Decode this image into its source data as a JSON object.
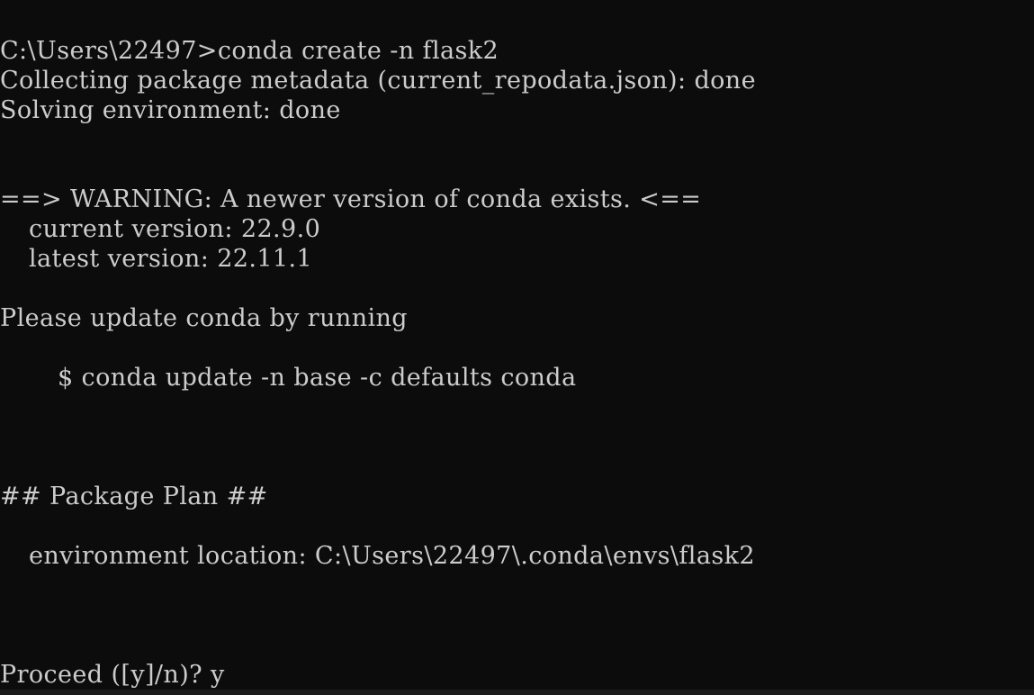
{
  "terminal": {
    "lines": {
      "cmd": "C:\\Users\\22497>conda create -n flask2",
      "collecting": "Collecting package metadata (current_repodata.json): done",
      "solving": "Solving environment: done",
      "warning": "==> WARNING: A newer version of conda exists. <==",
      "current_version": "current version: 22.9.0",
      "latest_version": "latest version: 22.11.1",
      "please_update": "Please update conda by running",
      "update_cmd": "$ conda update -n base -c defaults conda",
      "package_plan": "## Package Plan ##",
      "env_location": "environment location: C:\\Users\\22497\\.conda\\envs\\flask2",
      "proceed": "Proceed ([y]/n)? y"
    },
    "background": "#0c0c0c",
    "foreground": "#cccccc"
  }
}
